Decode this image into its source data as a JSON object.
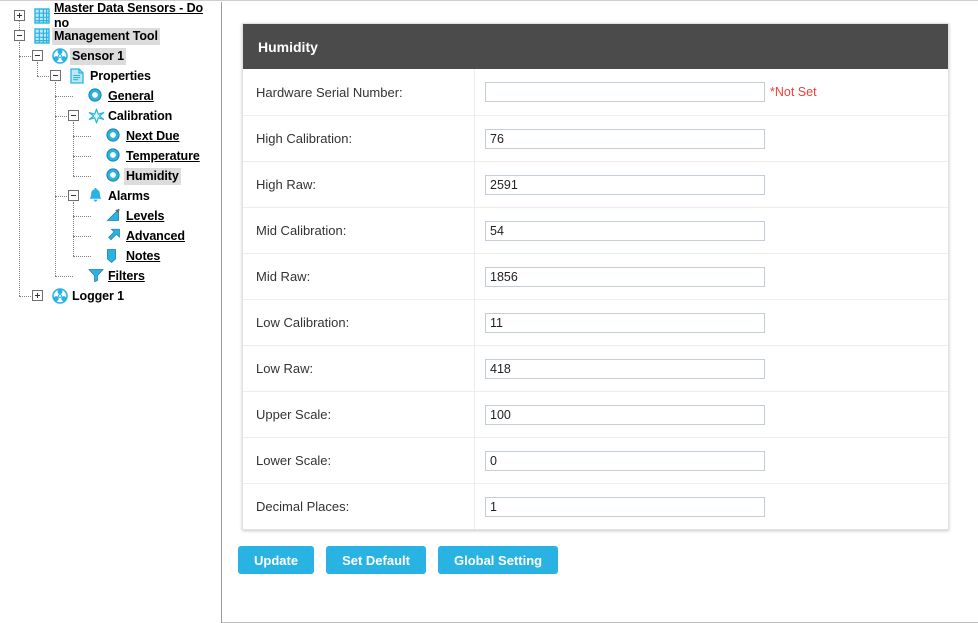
{
  "tree": {
    "nodes": [
      {
        "id": "master-data-sensors",
        "label": "Master Data Sensors - Do no",
        "icon": "grid-icon",
        "depth": 0,
        "state": "link",
        "expander": "plus"
      },
      {
        "id": "management-tool",
        "label": "Management Tool",
        "icon": "grid-icon",
        "depth": 0,
        "state": "selected",
        "expander": "minus"
      },
      {
        "id": "sensor-1",
        "label": "Sensor 1",
        "icon": "sensor-icon",
        "depth": 1,
        "state": "selected",
        "expander": "minus"
      },
      {
        "id": "properties",
        "label": "Properties",
        "icon": "document-icon",
        "depth": 2,
        "state": "plain",
        "expander": "minus"
      },
      {
        "id": "general",
        "label": "General",
        "icon": "circle-icon",
        "depth": 3,
        "state": "link",
        "expander": "none"
      },
      {
        "id": "calibration",
        "label": "Calibration",
        "icon": "star-icon",
        "depth": 3,
        "state": "plain",
        "expander": "minus"
      },
      {
        "id": "next-due",
        "label": "Next Due",
        "icon": "circle-icon",
        "depth": 4,
        "state": "link",
        "expander": "none"
      },
      {
        "id": "temperature",
        "label": "Temperature",
        "icon": "circle-icon",
        "depth": 4,
        "state": "link",
        "expander": "none"
      },
      {
        "id": "humidity",
        "label": "Humidity",
        "icon": "circle-icon",
        "depth": 4,
        "state": "selected",
        "expander": "none"
      },
      {
        "id": "alarms",
        "label": "Alarms",
        "icon": "bell-icon",
        "depth": 3,
        "state": "plain",
        "expander": "minus"
      },
      {
        "id": "levels",
        "label": "Levels",
        "icon": "levels-icon",
        "depth": 4,
        "state": "link",
        "expander": "none"
      },
      {
        "id": "advanced",
        "label": "Advanced",
        "icon": "arrow-icon",
        "depth": 4,
        "state": "link",
        "expander": "none"
      },
      {
        "id": "notes",
        "label": "Notes",
        "icon": "note-icon",
        "depth": 4,
        "state": "link",
        "expander": "none"
      },
      {
        "id": "filters",
        "label": "Filters",
        "icon": "funnel-icon",
        "depth": 3,
        "state": "link",
        "expander": "none"
      },
      {
        "id": "logger-1",
        "label": "Logger 1",
        "icon": "sensor-icon",
        "depth": 1,
        "state": "plain",
        "expander": "plus"
      }
    ]
  },
  "panel": {
    "title": "Humidity",
    "fields": [
      {
        "id": "hardware-serial-number",
        "label": "Hardware Serial Number:",
        "value": "",
        "placeholder": "",
        "note": "*Not Set"
      },
      {
        "id": "high-calibration",
        "label": "High Calibration:",
        "value": "76",
        "placeholder": "",
        "note": ""
      },
      {
        "id": "high-raw",
        "label": "High Raw:",
        "value": "2591",
        "placeholder": "",
        "note": ""
      },
      {
        "id": "mid-calibration",
        "label": "Mid Calibration:",
        "value": "54",
        "placeholder": "",
        "note": ""
      },
      {
        "id": "mid-raw",
        "label": "Mid Raw:",
        "value": "1856",
        "placeholder": "",
        "note": ""
      },
      {
        "id": "low-calibration",
        "label": "Low Calibration:",
        "value": "11",
        "placeholder": "",
        "note": ""
      },
      {
        "id": "low-raw",
        "label": "Low Raw:",
        "value": "418",
        "placeholder": "",
        "note": ""
      },
      {
        "id": "upper-scale",
        "label": "Upper Scale:",
        "value": "100",
        "placeholder": "",
        "note": ""
      },
      {
        "id": "lower-scale",
        "label": "Lower Scale:",
        "value": "0",
        "placeholder": "",
        "note": ""
      },
      {
        "id": "decimal-places",
        "label": "Decimal Places:",
        "value": "1",
        "placeholder": "",
        "note": ""
      }
    ],
    "buttons": [
      {
        "id": "update",
        "label": "Update"
      },
      {
        "id": "set-default",
        "label": "Set Default"
      },
      {
        "id": "global-setting",
        "label": "Global Setting"
      }
    ]
  },
  "colors": {
    "header_bg": "#4b4b4b",
    "button_bg": "#29b3e3",
    "icon_blue": "#29b3e3",
    "note_red": "#e8433c",
    "selection_bg": "#dcdcdc"
  }
}
